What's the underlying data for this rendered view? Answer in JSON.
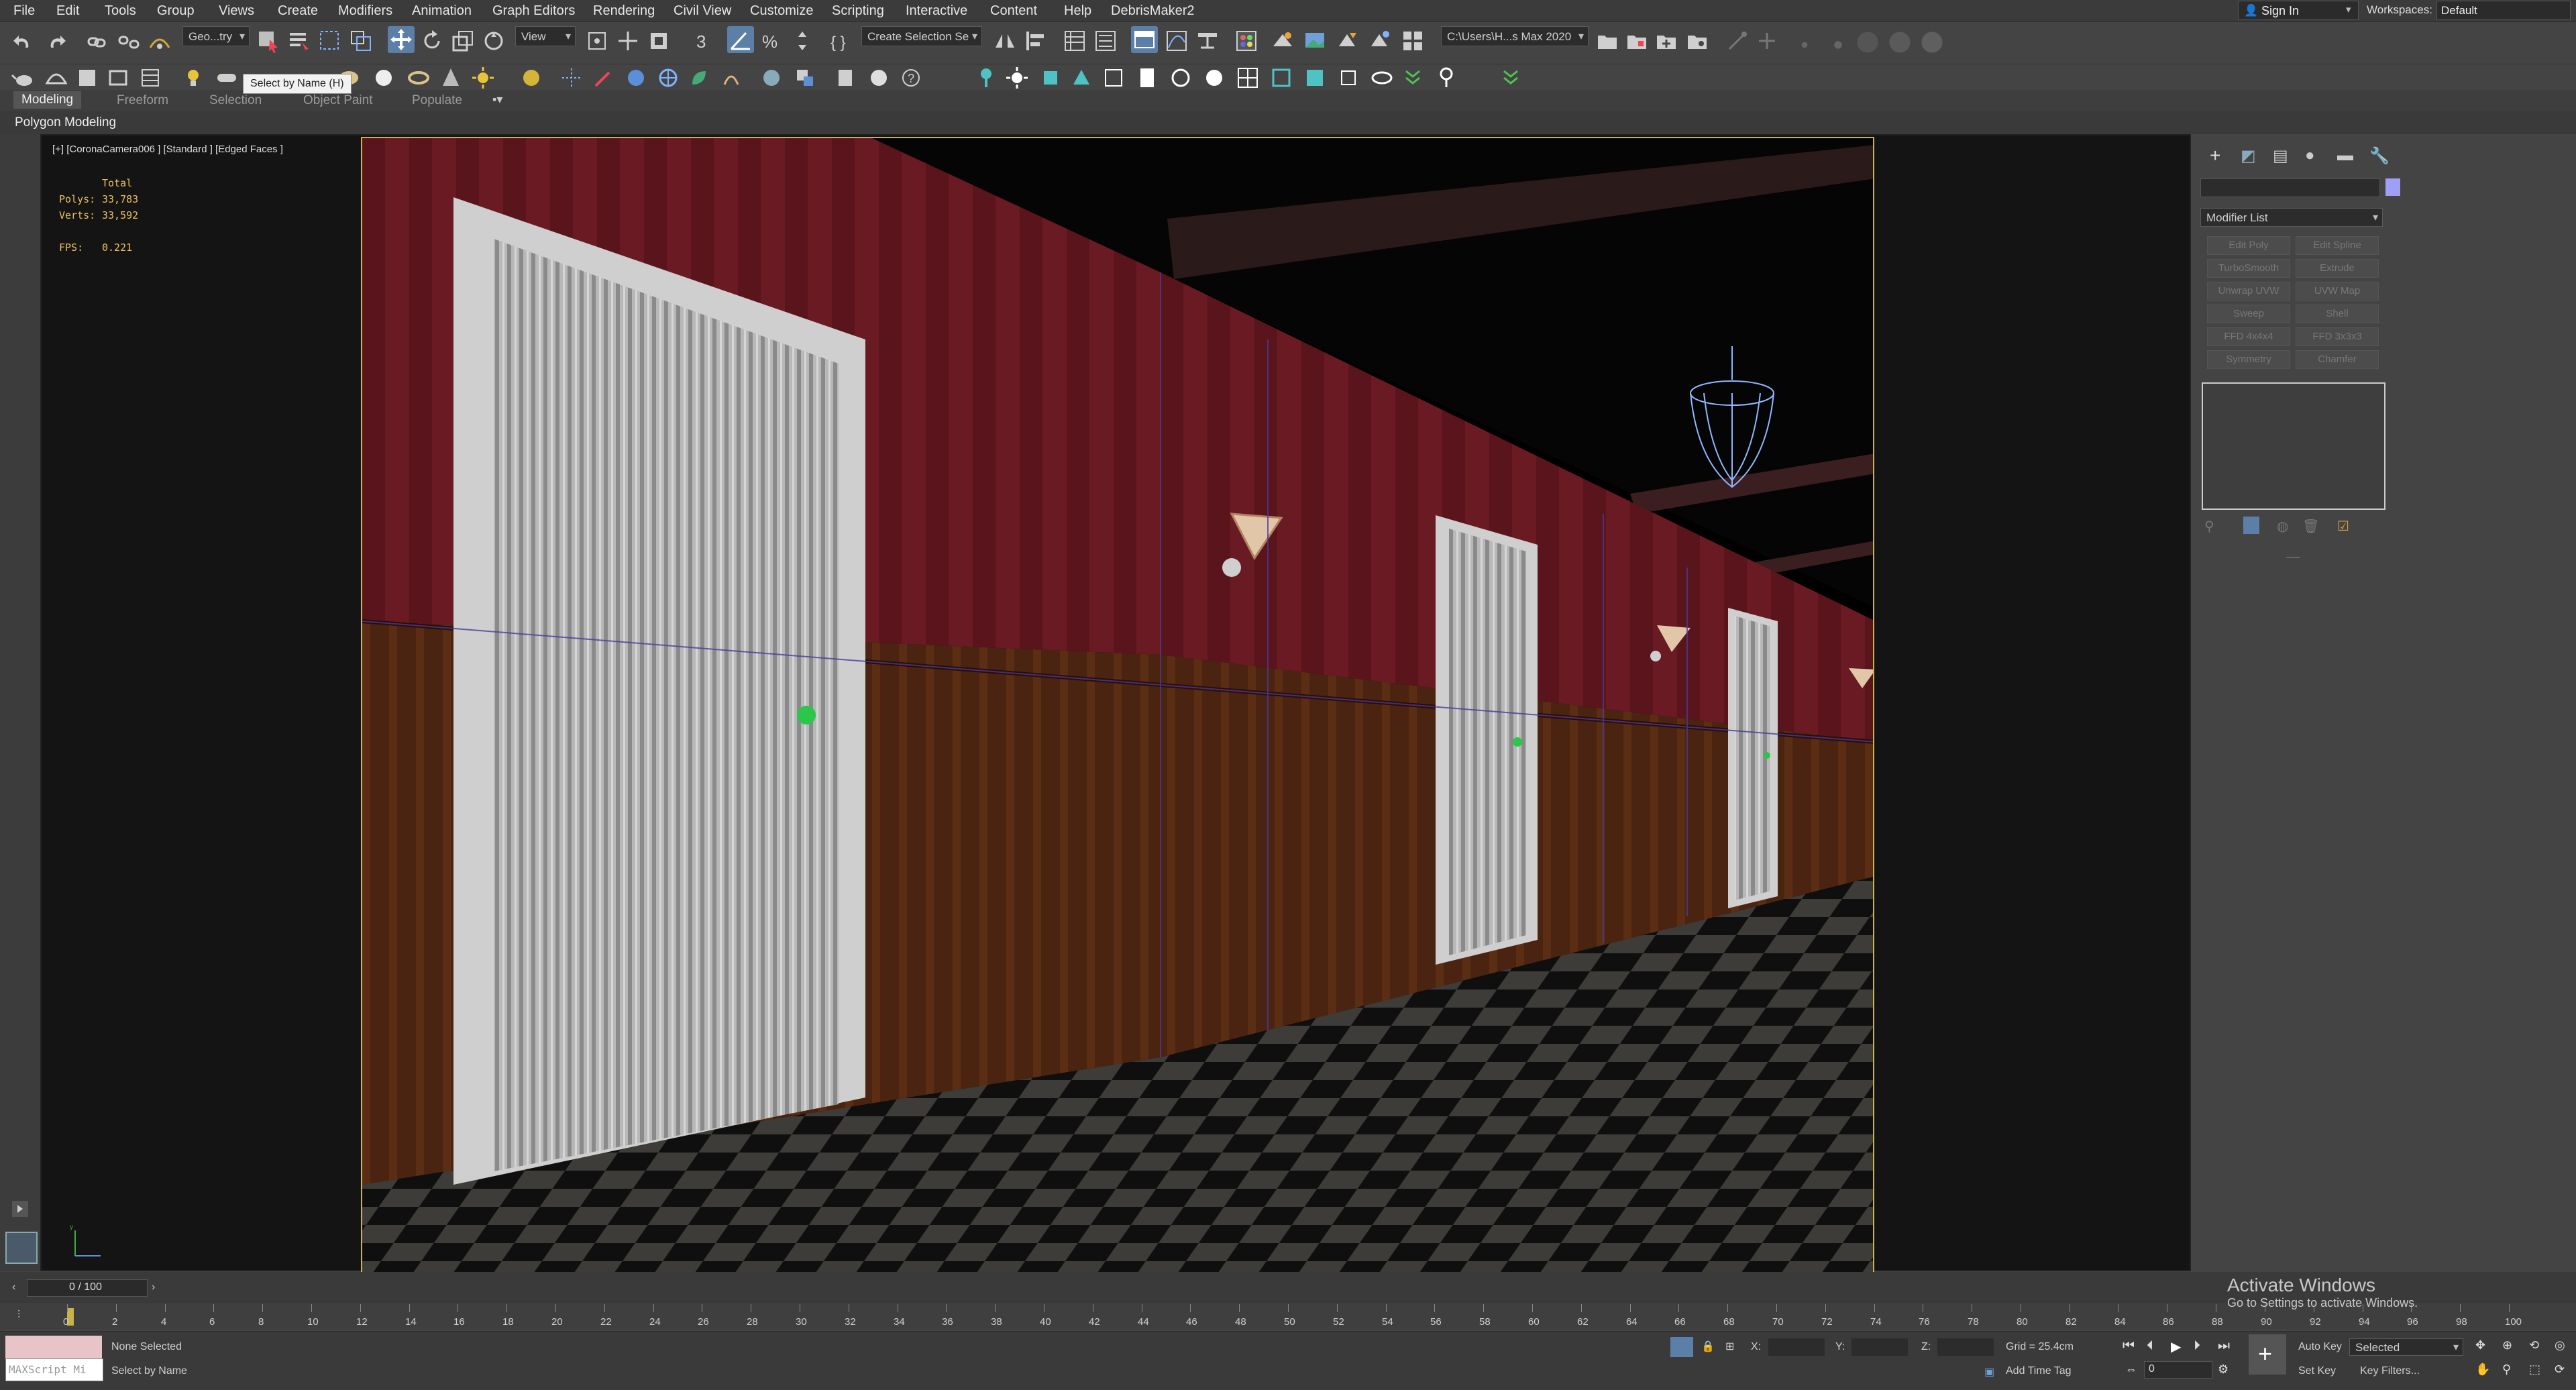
{
  "menu": [
    "File",
    "Edit",
    "Tools",
    "Group",
    "Views",
    "Create",
    "Modifiers",
    "Animation",
    "Graph Editors",
    "Rendering",
    "Civil View",
    "Customize",
    "Scripting",
    "Interactive",
    "Content",
    "Help",
    "DebrisMaker2"
  ],
  "account": {
    "sign_in": "Sign In",
    "workspaces_label": "Workspaces:",
    "workspace_value": "Default"
  },
  "toolbar": {
    "selection_filter": "Geo...try",
    "reference_coord": "View",
    "named_selection": "Create Selection Se",
    "project_path": "C:\\Users\\H...s Max 2020",
    "tooltip": "Select by Name   (H)"
  },
  "ribbon": {
    "tabs": [
      "Modeling",
      "Freeform",
      "Selection",
      "Object Paint",
      "Populate"
    ],
    "active": "Modeling",
    "sub": "Polygon Modeling"
  },
  "viewport": {
    "label": "[+] [CoronaCamera006 ] [Standard ] [Edged Faces ]",
    "stats": {
      "total": "Total",
      "polys_label": "Polys:",
      "polys": "33,783",
      "verts_label": "Verts:",
      "verts": "33,592",
      "fps_label": "FPS:",
      "fps": "0.221"
    }
  },
  "command_panel": {
    "modifier_list": "Modifier List",
    "buttons": [
      "Edit Poly",
      "Edit Spline",
      "TurboSmooth",
      "Extrude",
      "Unwrap UVW",
      "UVW Map",
      "Sweep",
      "Shell",
      "FFD 4x4x4",
      "FFD 3x3x3",
      "Symmetry",
      "Chamfer"
    ]
  },
  "timeline": {
    "frame": "0 / 100",
    "ticks": [
      "0",
      "2",
      "4",
      "6",
      "8",
      "10",
      "12",
      "14",
      "16",
      "18",
      "20",
      "22",
      "24",
      "26",
      "28",
      "30",
      "32",
      "34",
      "36",
      "38",
      "40",
      "42",
      "44",
      "46",
      "48",
      "50",
      "52",
      "54",
      "56",
      "58",
      "60",
      "62",
      "64",
      "66",
      "68",
      "70",
      "72",
      "74",
      "76",
      "78",
      "80",
      "82",
      "84",
      "86",
      "88",
      "90",
      "92",
      "94",
      "96",
      "98",
      "100"
    ]
  },
  "status": {
    "selection": "None Selected",
    "hint": "Select by Name",
    "maxscript": "MAXScript Mi",
    "x_label": "X:",
    "y_label": "Y:",
    "z_label": "Z:",
    "grid": "Grid = 25.4cm",
    "add_time_tag": "Add Time Tag",
    "auto_key": "Auto Key",
    "set_key": "Set Key",
    "selected_dd": "Selected",
    "key_filters": "Key Filters...",
    "frame_field": "0"
  },
  "watermark": {
    "title": "Activate Windows",
    "body": "Go to Settings to activate Windows."
  }
}
